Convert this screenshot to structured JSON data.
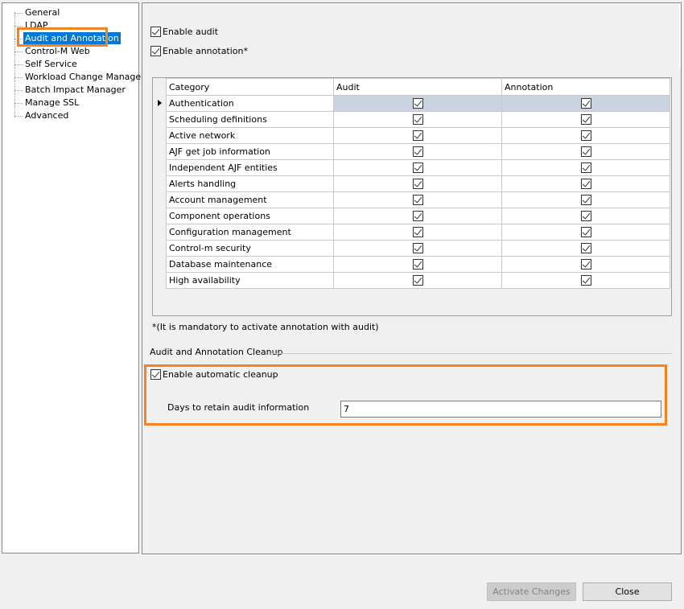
{
  "tree": {
    "items": [
      {
        "label": "General"
      },
      {
        "label": "LDAP"
      },
      {
        "label": "Audit and Annotation"
      },
      {
        "label": "Control-M Web"
      },
      {
        "label": "Self Service"
      },
      {
        "label": "Workload Change Manager"
      },
      {
        "label": "Batch Impact Manager"
      },
      {
        "label": "Manage SSL"
      },
      {
        "label": "Advanced"
      }
    ],
    "selected": "Audit and Annotation"
  },
  "options": {
    "enable_audit": {
      "label": "Enable audit",
      "checked": true
    },
    "enable_annotation": {
      "label": "Enable annotation*",
      "checked": true
    }
  },
  "grid": {
    "headers": [
      "Category",
      "Audit",
      "Annotation"
    ],
    "rows": [
      {
        "category": "Authentication",
        "audit": true,
        "annotation": true
      },
      {
        "category": "Scheduling definitions",
        "audit": true,
        "annotation": true
      },
      {
        "category": "Active network",
        "audit": true,
        "annotation": true
      },
      {
        "category": "AJF get job information",
        "audit": true,
        "annotation": true
      },
      {
        "category": "Independent AJF entities",
        "audit": true,
        "annotation": true
      },
      {
        "category": "Alerts handling",
        "audit": true,
        "annotation": true
      },
      {
        "category": "Account management",
        "audit": true,
        "annotation": true
      },
      {
        "category": "Component operations",
        "audit": true,
        "annotation": true
      },
      {
        "category": "Configuration management",
        "audit": true,
        "annotation": true
      },
      {
        "category": "Control-m security",
        "audit": true,
        "annotation": true
      },
      {
        "category": "Database maintenance",
        "audit": true,
        "annotation": true
      },
      {
        "category": "High availability",
        "audit": true,
        "annotation": true
      }
    ]
  },
  "note": "*(It is mandatory to activate annotation with audit)",
  "cleanup": {
    "section_title": "Audit and Annotation Cleanup",
    "enable_label": "Enable automatic cleanup",
    "enabled": true,
    "days_label": "Days to retain audit information",
    "days_value": "7"
  },
  "buttons": {
    "activate": "Activate Changes",
    "close": "Close"
  },
  "colors": {
    "highlight": "#f58220",
    "selection": "#0078d7"
  }
}
